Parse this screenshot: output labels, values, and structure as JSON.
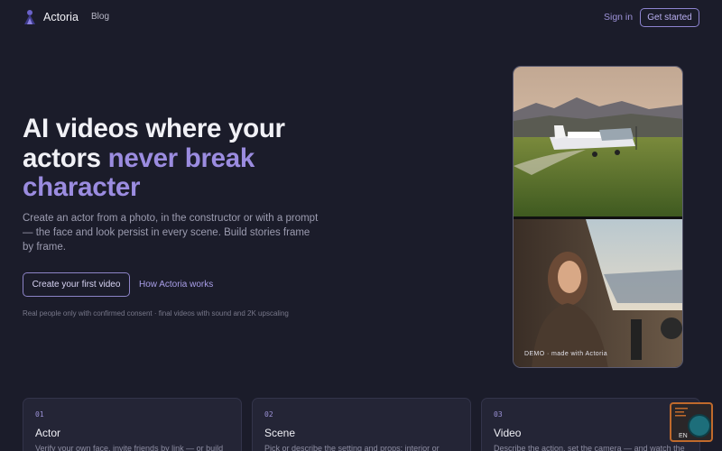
{
  "header": {
    "brand": "Actoria",
    "nav_blog": "Blog",
    "sign_in": "Sign in",
    "get_started": "Get started"
  },
  "hero": {
    "headline_plain": "AI videos where your actors ",
    "headline_accent": "never break character",
    "subtitle": "Create an actor from a photo, in the constructor or with a prompt — the face and look persist in every scene. Build stories frame by frame.",
    "cta_primary": "Create your first video",
    "cta_secondary": "How Actoria works",
    "consent_note": "Real people only with confirmed consent · final videos with sound and 2K upscaling"
  },
  "media": {
    "demo_label": "DEMO · made with Actoria"
  },
  "steps": [
    {
      "num": "01",
      "title": "Actor",
      "desc": "Verify your own face, invite friends by link — or build"
    },
    {
      "num": "02",
      "title": "Scene",
      "desc": "Pick or describe the setting and props: interior or"
    },
    {
      "num": "03",
      "title": "Video",
      "desc": "Describe the action, set the camera — and watch the"
    }
  ],
  "widget": {
    "lang": "EN"
  },
  "colors": {
    "background": "#1b1c2a",
    "accent": "#9b8ce0",
    "card": "#242536"
  }
}
